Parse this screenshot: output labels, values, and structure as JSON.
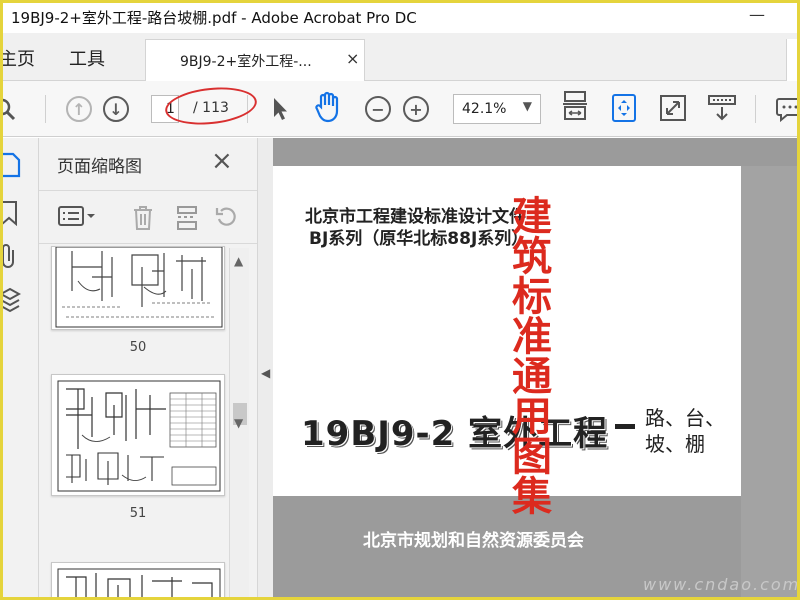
{
  "window": {
    "title": "19BJ9-2+室外工程-路台坡棚.pdf - Adobe Acrobat Pro DC",
    "minimize": "—"
  },
  "tabs": {
    "home": "主页",
    "tools": "工具",
    "document_tab": "9BJ9-2+室外工程-...",
    "close": "×"
  },
  "toolbar": {
    "current_page": "1",
    "page_total": "/ 113",
    "zoom": "42.1%",
    "zoom_caret": "▼",
    "prev_page": "↑",
    "next_page": "↓",
    "zoom_out": "−",
    "zoom_in": "+"
  },
  "panel": {
    "title": "页面缩略图",
    "close": "×",
    "thumbnails": [
      {
        "page": "50"
      },
      {
        "page": "51"
      }
    ]
  },
  "document": {
    "header_line1": "北京市工程建设标准设计文件",
    "header_line2": "BJ系列（原华北标88J系列）",
    "code_title": "19BJ9-2 室外工程",
    "subtitle_line1": "路、台、",
    "subtitle_line2": "坡、棚",
    "vertical_red": "建筑标准通用图集",
    "footer": "北京市规划和自然资源委员会"
  },
  "watermark": "www.cndao.com",
  "colors": {
    "accent_blue": "#1473e6",
    "red_annotation": "#d93030",
    "red_text": "#dc2a1e",
    "frame": "#e5d43c"
  }
}
